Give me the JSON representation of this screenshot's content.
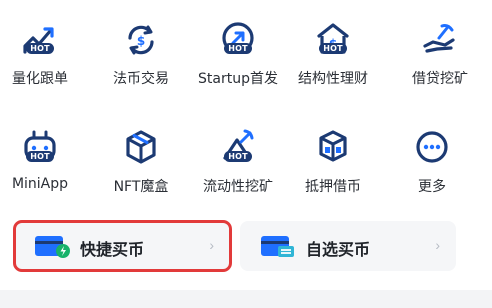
{
  "grid": {
    "row1": [
      {
        "label": "量化跟单",
        "icon": "chart-trend-icon",
        "hot": "HOT"
      },
      {
        "label": "法币交易",
        "icon": "dollar-exchange-icon"
      },
      {
        "label": "Startup首发",
        "icon": "launch-arrow-icon",
        "hot": "HOT"
      },
      {
        "label": "结构性理财",
        "icon": "bank-dollar-icon",
        "hot": "HOT"
      },
      {
        "label": "借贷挖矿",
        "icon": "hand-pickaxe-icon"
      }
    ],
    "row2": [
      {
        "label": "MiniApp",
        "icon": "gamepad-icon",
        "hot": "HOT"
      },
      {
        "label": "NFT魔盒",
        "icon": "cube-box-icon"
      },
      {
        "label": "流动性挖矿",
        "icon": "pickaxe-icon",
        "hot": "HOT"
      },
      {
        "label": "抵押借币",
        "icon": "stacked-cubes-icon"
      },
      {
        "label": "更多",
        "icon": "more-dots-icon"
      }
    ]
  },
  "buttons": {
    "quick_buy": {
      "label": "快捷买币",
      "chevron": "›",
      "icon": "card-lightning-icon"
    },
    "self_buy": {
      "label": "自选买币",
      "chevron": "›",
      "icon": "card-equal-icon"
    }
  },
  "colors": {
    "accent": "#1f6fff",
    "dark": "#1c3a73",
    "highlight": "#e23a3a"
  }
}
